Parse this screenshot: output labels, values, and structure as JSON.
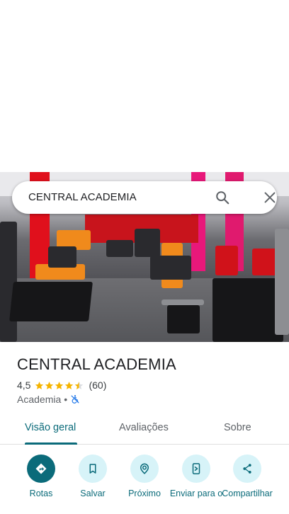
{
  "search": {
    "query": "CENTRAL ACADEMIA"
  },
  "photo": {
    "alt_name": "gym-interior-photo"
  },
  "place": {
    "title": "CENTRAL ACADEMIA",
    "rating": "4,5",
    "stars_value": 4.5,
    "review_count": "(60)",
    "category": "Academia",
    "separator": "•"
  },
  "tabs": [
    {
      "label": "Visão geral",
      "active": true
    },
    {
      "label": "Avaliações",
      "active": false
    },
    {
      "label": "Sobre",
      "active": false
    }
  ],
  "actions": [
    {
      "label": "Rotas",
      "icon": "directions-icon"
    },
    {
      "label": "Salvar",
      "icon": "bookmark-icon"
    },
    {
      "label": "Próximo",
      "icon": "nearby-icon"
    },
    {
      "label": "Enviar para o",
      "icon": "send-to-phone-icon"
    },
    {
      "label": "Compartilhar",
      "icon": "share-icon"
    }
  ],
  "colors": {
    "accent": "#0b6b7a",
    "accent_light": "#d7f3f8",
    "star": "#f5b400",
    "gym_red": "#e0101c",
    "gym_orange": "#f08a1c"
  }
}
